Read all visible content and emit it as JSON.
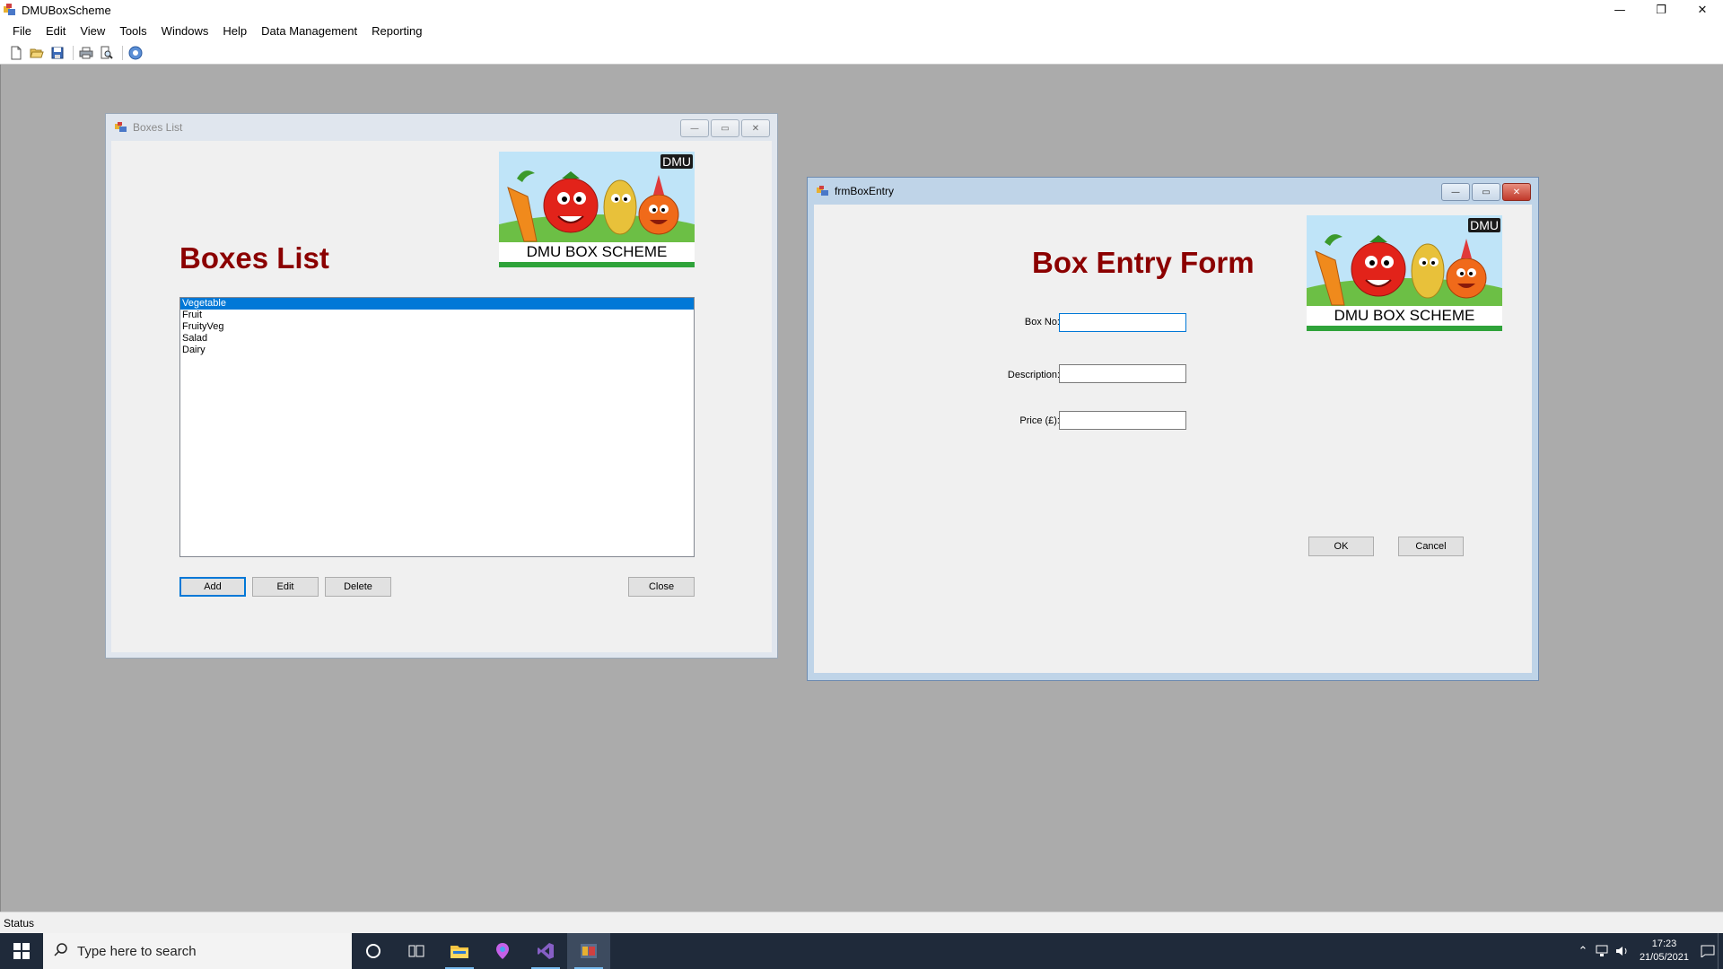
{
  "app": {
    "title": "DMUBoxScheme"
  },
  "window_controls": {
    "minimize": "—",
    "restore": "❐",
    "close": "✕"
  },
  "menu": [
    "File",
    "Edit",
    "View",
    "Tools",
    "Windows",
    "Help",
    "Data Management",
    "Reporting"
  ],
  "toolbar": {
    "icons": [
      "new-icon",
      "open-icon",
      "save-icon",
      "print-icon",
      "print-preview-icon",
      "help-icon"
    ]
  },
  "status": {
    "text": "Status"
  },
  "logo": {
    "caption": "DMU BOX SCHEME",
    "tag": "DMU"
  },
  "boxes_list_form": {
    "title": "Boxes List",
    "heading": "Boxes List",
    "items": [
      "Vegetable",
      "Fruit",
      "FruityVeg",
      "Salad",
      "Dairy"
    ],
    "selected_index": 0,
    "buttons": {
      "add": "Add",
      "edit": "Edit",
      "delete": "Delete",
      "close": "Close"
    }
  },
  "box_entry_form": {
    "title": "frmBoxEntry",
    "heading": "Box Entry Form",
    "fields": {
      "box_no": {
        "label": "Box No:",
        "value": ""
      },
      "description": {
        "label": "Description:",
        "value": ""
      },
      "price": {
        "label": "Price (£):",
        "value": ""
      }
    },
    "buttons": {
      "ok": "OK",
      "cancel": "Cancel"
    }
  },
  "taskbar": {
    "search_placeholder": "Type here to search",
    "apps": [
      "cortana-icon",
      "task-view-icon",
      "file-explorer-icon",
      "maps-icon",
      "visual-studio-icon",
      "dmu-app-icon"
    ],
    "time": "17:23",
    "date": "21/05/2021"
  },
  "colors": {
    "heading": "#8b0000",
    "selection": "#0078d7",
    "mdi_background": "#ababab",
    "taskbar": "#1f2a3a"
  }
}
